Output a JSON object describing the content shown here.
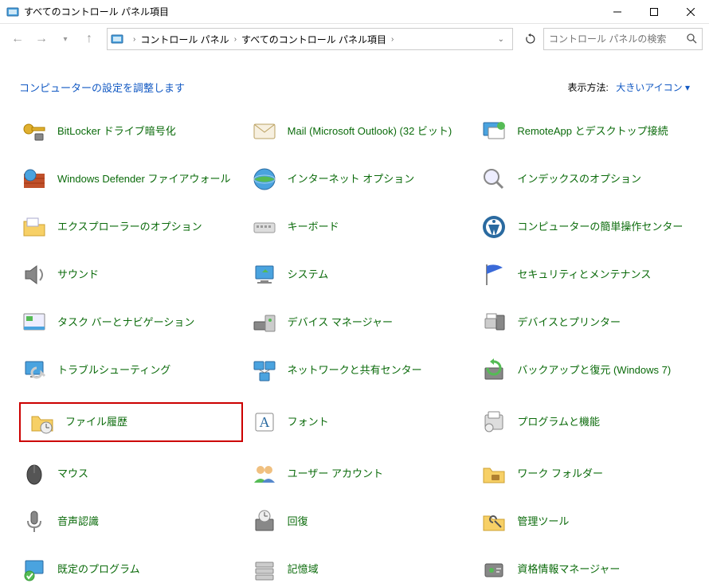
{
  "window": {
    "title": "すべてのコントロール パネル項目"
  },
  "breadcrumb": {
    "item1": "コントロール パネル",
    "item2": "すべてのコントロール パネル項目"
  },
  "search": {
    "placeholder": "コントロール パネルの検索"
  },
  "header": {
    "adjust": "コンピューターの設定を調整します",
    "view_label": "表示方法:",
    "view_value": "大きいアイコン"
  },
  "items": {
    "bitlocker": "BitLocker ドライブ暗号化",
    "mail": "Mail (Microsoft Outlook) (32 ビット)",
    "remoteapp": "RemoteApp とデスクトップ接続",
    "defender": "Windows Defender ファイアウォール",
    "internet": "インターネット オプション",
    "index": "インデックスのオプション",
    "explorer": "エクスプローラーのオプション",
    "keyboard": "キーボード",
    "ease": "コンピューターの簡単操作センター",
    "sound": "サウンド",
    "system": "システム",
    "security": "セキュリティとメンテナンス",
    "taskbar": "タスク バーとナビゲーション",
    "device_mgr": "デバイス マネージャー",
    "devices": "デバイスとプリンター",
    "troubleshoot": "トラブルシューティング",
    "network": "ネットワークと共有センター",
    "backup": "バックアップと復元 (Windows 7)",
    "filehistory": "ファイル履歴",
    "fonts": "フォント",
    "programs": "プログラムと機能",
    "mouse": "マウス",
    "users": "ユーザー アカウント",
    "workfolder": "ワーク フォルダー",
    "speech": "音声認識",
    "recovery": "回復",
    "admintools": "管理ツール",
    "defaults": "既定のプログラム",
    "storage": "記憶域",
    "credentials": "資格情報マネージャー"
  }
}
